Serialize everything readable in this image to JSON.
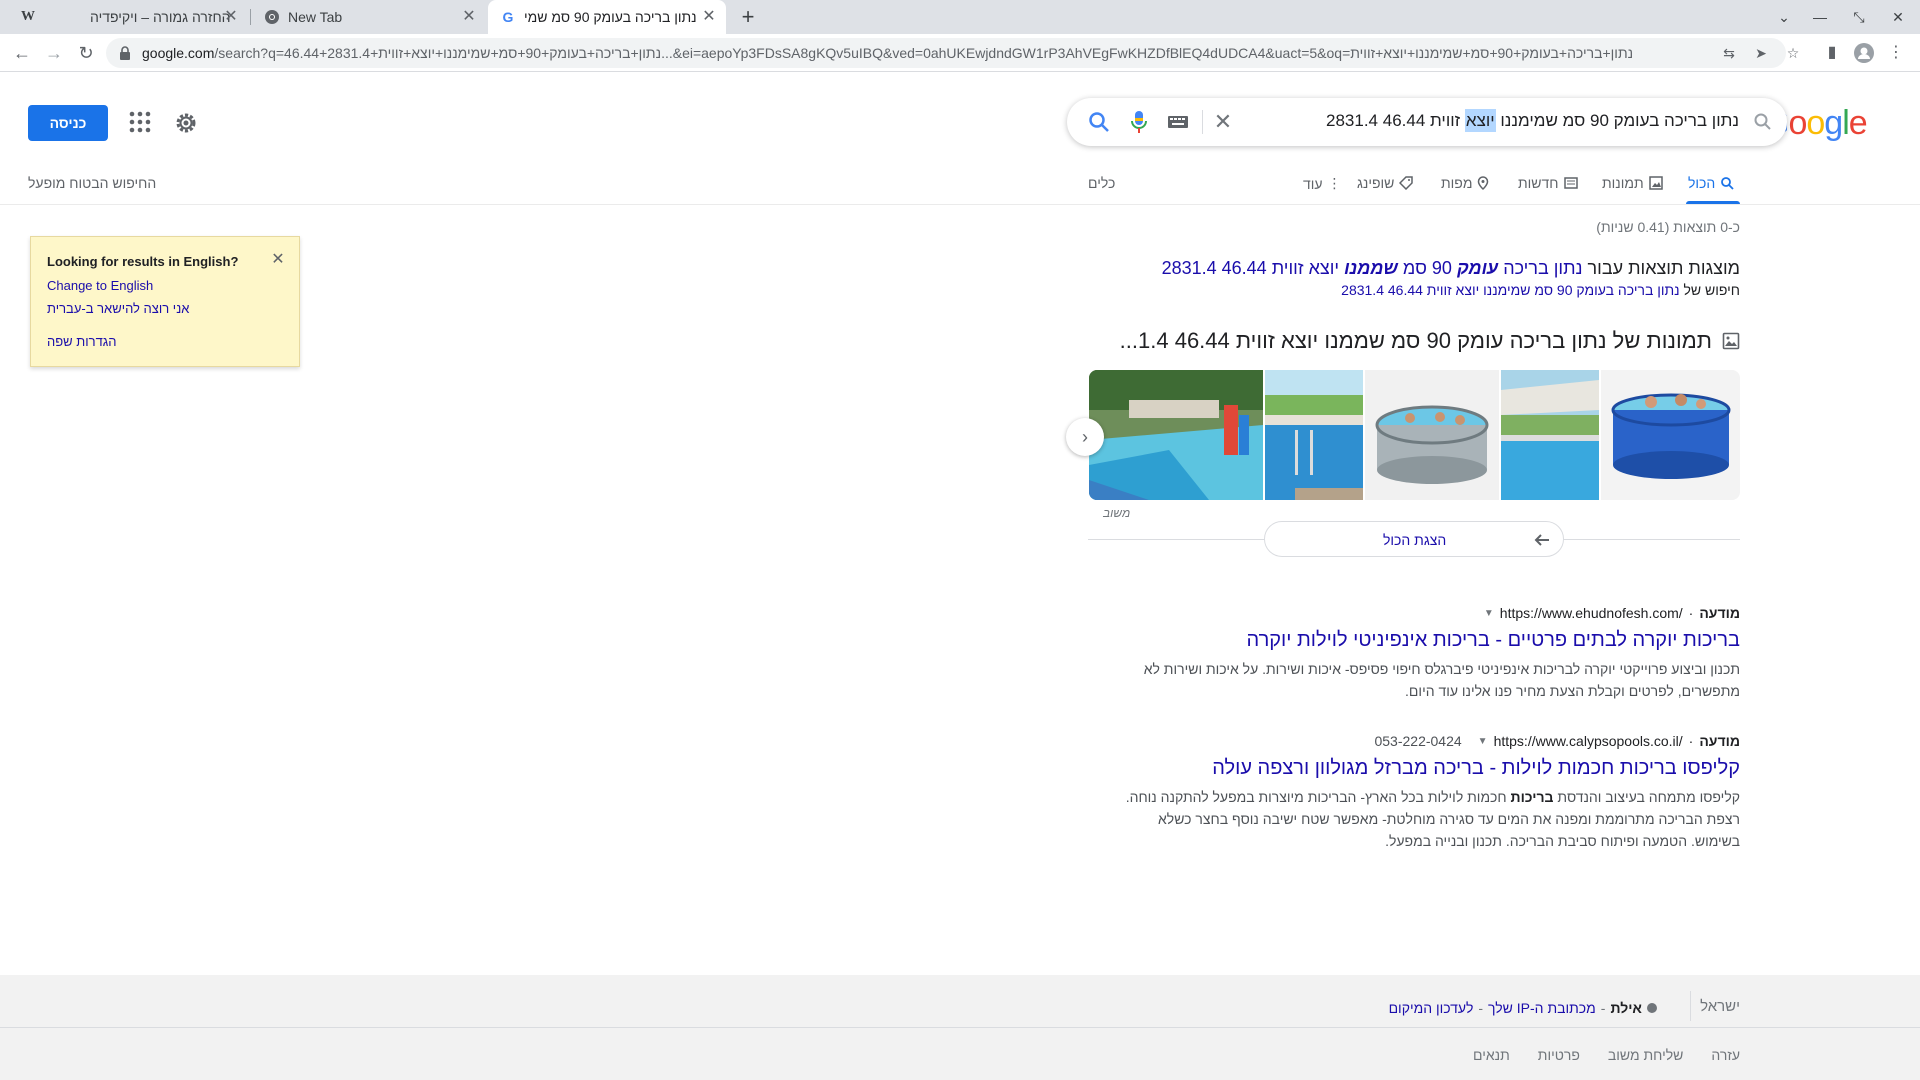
{
  "browser": {
    "tabs": [
      {
        "title": "החזרה גמורה – ויקיפדיה",
        "favicon": "wikipedia-icon"
      },
      {
        "title": "New Tab",
        "favicon": "chrome-icon"
      },
      {
        "title": "נתון בריכה בעומק 90 סמ שמי",
        "favicon": "google-icon"
      }
    ],
    "url_host": "google.com",
    "url_path": "/search?q=46.44+2831.4+נתון+בריכה+בעומק+90+סמ+שמימננו+יוצא+זווית...&ei=aepoYp3FDsSA8gKQv5uIBQ&ved=0ahUKEwjdndGW1rP3AhVEgFwKHZDfBlEQ4dUDCA4&uact=5&oq=נתון+בריכה+בעומק+90+סמ+שמימננו+יוצא+זווית"
  },
  "header": {
    "logo": "Google",
    "query_before": "נתון בריכה בעומק 90 סמ שמימננו ",
    "query_highlight": "יוצא",
    "query_after": " זווית 46.44 2831.4",
    "signin_label": "כניסה",
    "tabs": [
      "הכול",
      "תמונות",
      "חדשות",
      "מפות",
      "שופינג",
      "עוד"
    ],
    "tools": "כלים",
    "safesearch": "החיפוש הבטוח מופעל"
  },
  "results": {
    "stats": "כ-0 תוצאות (0.41 שניות)",
    "showing_prefix": "מוצגות תוצאות עבור ",
    "showing_link_1": "נתון בריכה ",
    "showing_bold_1": "עומק",
    "showing_link_2": " 90 סמ ",
    "showing_bold_2": "שממנו",
    "showing_link_3": " יוצא זווית 46.44 2831.4",
    "instead_prefix": "חיפוש של ",
    "instead_link": "נתון בריכה בעומק 90 סמ שמימננו יוצא זווית 46.44 2831.4",
    "images_heading": "תמונות של נתון בריכה עומק 90 סמ שממנו יוצא זווית 46.44 1.4...",
    "feedback": "משוב",
    "view_all": "הצגת הכול",
    "ads": [
      {
        "label": "מודעה",
        "url": "https://www.ehudnofesh.com/",
        "phone": "",
        "title": "בריכות יוקרה לבתים פרטיים - בריכות אינפיניטי לוילות יוקרה",
        "snippet": "תכנון וביצוע פרוייקטי יוקרה לבריכות אינפיניטי פיברגלס חיפוי פסיפס- איכות ושירות. על איכות ושירות לא מתפשרים, לפרטים וקבלת הצעת מחיר פנו אלינו עוד היום."
      },
      {
        "label": "מודעה",
        "url": "https://www.calypsopools.co.il/",
        "phone": "053-222-0424",
        "title": "קליפסו בריכות חכמות לוילות - בריכה מברזל מגולוון ורצפה עולה",
        "snippet_before": "קליפסו מתמחה בעיצוב והנדסת ",
        "snippet_bold": "בריכות",
        "snippet_after": " חכמות לוילות בכל הארץ- הבריכות מיוצרות במפעל להתקנה נוחה. רצפת הבריכה מתרוממת ומפנה את המים עד סגירה מוחלטת- מאפשר שטח ישיבה נוסף בחצר כשלא בשימוש. הטמעה ופיתוח סביבת הבריכה. תכנון ובנייה במפעל."
      }
    ]
  },
  "language_popup": {
    "title": "Looking for results in English?",
    "change": "Change to English",
    "stay": "אני רוצה להישאר ב-עברית",
    "settings": "הגדרות שפה"
  },
  "footer": {
    "country": "ישראל",
    "city": "אילת",
    "from_ip": "מכתובת ה-IP שלך",
    "update": "לעדכון המיקום",
    "links": [
      "עזרה",
      "שליחת משוב",
      "פרטיות",
      "תנאים"
    ]
  },
  "colors": {
    "accent": "#1a73e8",
    "link": "#1a0dab",
    "popup_bg": "#fef7c9"
  }
}
